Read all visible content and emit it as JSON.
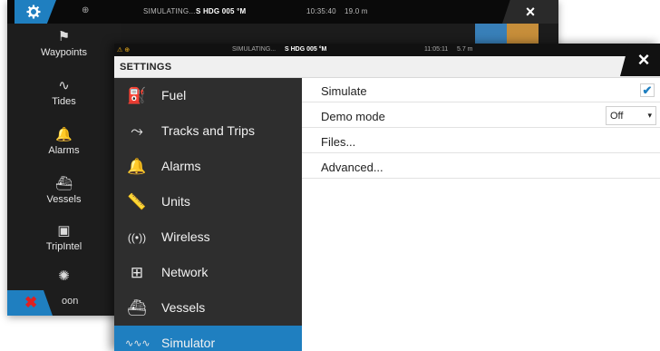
{
  "background_window": {
    "status": {
      "sim_text": "SIMULATING...",
      "heading": "S HDG 005 °M",
      "time": "10:35:40",
      "distance": "19.0 m"
    },
    "close_label": "×",
    "sidebar": [
      {
        "label": "Waypoints",
        "icon": "waypoint-flag-icon",
        "glyph": "⚑"
      },
      {
        "label": "Tides",
        "icon": "tide-wave-icon",
        "glyph": "∿"
      },
      {
        "label": "Alarms",
        "icon": "alarm-bell-icon",
        "glyph": "🔔"
      },
      {
        "label": "Vessels",
        "icon": "vessel-icon",
        "glyph": "⛴"
      },
      {
        "label": "TripIntel",
        "icon": "tripintel-icon",
        "glyph": "▣"
      },
      {
        "label": "",
        "icon": "sun-moon-icon",
        "glyph": "✺"
      }
    ],
    "bottom_label": "oon"
  },
  "settings": {
    "status": {
      "sim_text": "SIMULATING...",
      "heading": "S HDG 005 °M",
      "time": "11:05:11",
      "distance": "5.7 m"
    },
    "title": "SETTINGS",
    "close_label": "×",
    "nav": [
      {
        "label": "Fuel",
        "icon": "fuel-icon",
        "glyph": "⛽",
        "active": false
      },
      {
        "label": "Tracks and Trips",
        "icon": "tracks-icon",
        "glyph": "⤳",
        "active": false
      },
      {
        "label": "Alarms",
        "icon": "alarm-bell-icon",
        "glyph": "🔔",
        "active": false
      },
      {
        "label": "Units",
        "icon": "ruler-icon",
        "glyph": "📏",
        "active": false
      },
      {
        "label": "Wireless",
        "icon": "wireless-icon",
        "glyph": "((•))",
        "active": false
      },
      {
        "label": "Network",
        "icon": "network-icon",
        "glyph": "⊞",
        "active": false
      },
      {
        "label": "Vessels",
        "icon": "vessel-icon",
        "glyph": "⛴",
        "active": false
      },
      {
        "label": "Simulator",
        "icon": "simulator-wave-icon",
        "glyph": "∿∿∿",
        "active": true
      }
    ],
    "rows": {
      "simulate": {
        "label": "Simulate",
        "checked": true,
        "check_glyph": "✔"
      },
      "demo_mode": {
        "label": "Demo mode",
        "value": "Off",
        "chevron": "▾"
      },
      "files": {
        "label": "Files..."
      },
      "advanced": {
        "label": "Advanced..."
      }
    }
  },
  "colors": {
    "accent": "#1f7fc0",
    "nav_bg": "#2e2e2e",
    "status_bg": "#111111",
    "warning": "#f3b21c",
    "close_x_red": "#e02020"
  }
}
